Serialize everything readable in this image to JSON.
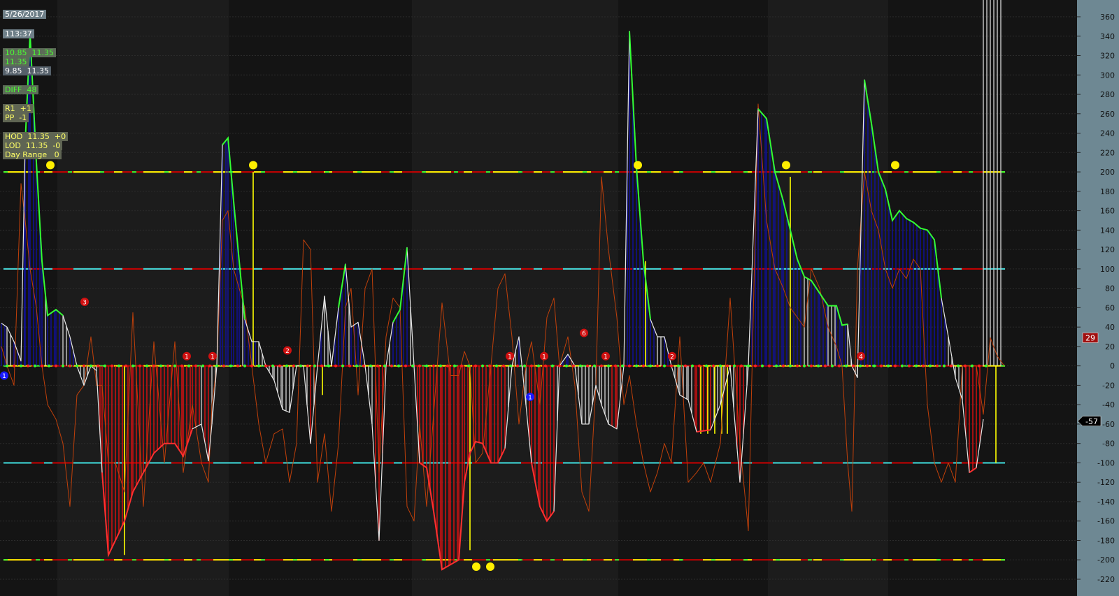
{
  "header": {
    "date": "5/26/2017",
    "price": "113:37",
    "bid_ask": "10.85  11.35",
    "last": "11.35",
    "range": "9.85  11.35",
    "diff": "DIFF  48",
    "r1": "R1  +1",
    "pp": "PP  -1",
    "hod": "HOD  11.35  +0",
    "lod": "LOD  11.35  -0",
    "day_range": "Day Range   0"
  },
  "colors": {
    "background": "#161616",
    "axis_panel": "#6e8893",
    "up_fill": "#1010a0",
    "down_fill": "#e01010",
    "neutral_stick": "#c8c8c8",
    "signal_stick": "#ffff00",
    "green_line": "#33ff33",
    "orange_line": "#c0400a",
    "cyan_level": "#40e0e0",
    "red_level": "#cc0000"
  },
  "chart_data": {
    "type": "line",
    "title": "",
    "xlabel": "",
    "ylabel": "",
    "ylim": [
      -220,
      360
    ],
    "y_ticks": [
      360,
      340,
      320,
      300,
      280,
      260,
      240,
      220,
      200,
      180,
      160,
      140,
      120,
      100,
      80,
      60,
      40,
      20,
      0,
      -20,
      -40,
      -60,
      -80,
      -100,
      -120,
      -140,
      -160,
      -180,
      -200,
      -220
    ],
    "grid": true,
    "reference_levels": [
      200,
      100,
      0,
      -100,
      -200
    ],
    "last_values": {
      "orange_series": 29,
      "main_series": -57
    },
    "x": [
      2,
      10,
      20,
      30,
      36,
      43,
      52,
      60,
      68,
      80,
      90,
      100,
      110,
      120,
      130,
      138,
      146,
      155,
      165,
      178,
      190,
      205,
      220,
      235,
      250,
      262,
      275,
      288,
      298,
      303,
      310,
      318,
      326,
      334,
      342,
      350,
      360,
      370,
      380,
      392,
      404,
      414,
      424,
      434,
      444,
      454,
      464,
      474,
      484,
      494,
      502,
      512,
      522,
      532,
      542,
      552,
      562,
      572,
      582,
      592,
      600,
      610,
      620,
      632,
      644,
      656,
      664,
      672,
      680,
      690,
      702,
      712,
      722,
      732,
      742,
      752,
      760,
      772,
      782,
      792,
      800,
      812,
      822,
      832,
      842,
      852,
      860,
      870,
      882,
      892,
      900,
      910,
      920,
      930,
      940,
      950,
      960,
      972,
      984,
      996,
      1006,
      1016,
      1030,
      1044,
      1058,
      1070,
      1084,
      1096,
      1108,
      1120,
      1130,
      1140,
      1150,
      1160,
      1172,
      1184,
      1196,
      1204,
      1212,
      1218,
      1226,
      1236,
      1246,
      1256,
      1266,
      1276,
      1286,
      1296,
      1306,
      1316,
      1326,
      1336,
      1346,
      1356,
      1366,
      1376,
      1386,
      1396,
      1406,
      1416,
      1426,
      1436
    ],
    "main_series": [
      44,
      40,
      25,
      5,
      230,
      342,
      210,
      108,
      52,
      58,
      52,
      30,
      0,
      -20,
      0,
      -5,
      -110,
      -195,
      -180,
      -160,
      -130,
      -110,
      -90,
      -80,
      -80,
      -93,
      -65,
      -60,
      -98,
      -60,
      0,
      228,
      235,
      170,
      108,
      48,
      25,
      25,
      0,
      -15,
      -45,
      -48,
      0,
      0,
      -80,
      0,
      72,
      0,
      60,
      105,
      40,
      45,
      0,
      -60,
      -180,
      0,
      45,
      58,
      122,
      0,
      -100,
      -105,
      -150,
      -210,
      -205,
      -200,
      -120,
      -90,
      -78,
      -80,
      -100,
      -100,
      -85,
      0,
      30,
      -40,
      -100,
      -145,
      -160,
      -150,
      0,
      12,
      0,
      -60,
      -60,
      -20,
      -40,
      -60,
      -65,
      0,
      345,
      205,
      108,
      48,
      30,
      30,
      0,
      -30,
      -35,
      -68,
      -67,
      -66,
      -40,
      0,
      -120,
      0,
      265,
      255,
      200,
      170,
      140,
      110,
      92,
      88,
      75,
      62,
      62,
      42,
      43,
      0,
      -12,
      295,
      250,
      200,
      182,
      150,
      160,
      152,
      148,
      142,
      140,
      130,
      70,
      30,
      -12,
      -35,
      -110,
      -105,
      -55
    ],
    "orange_series": [
      20,
      0,
      -20,
      188,
      150,
      100,
      60,
      0,
      -40,
      -55,
      -80,
      -145,
      -30,
      -20,
      30,
      -20,
      -20,
      -100,
      -100,
      -130,
      55,
      -145,
      25,
      -100,
      25,
      -110,
      -40,
      -100,
      -120,
      -40,
      0,
      150,
      160,
      100,
      80,
      60,
      0,
      -60,
      -100,
      -70,
      -65,
      -120,
      -80,
      130,
      120,
      -120,
      -70,
      -150,
      -80,
      60,
      80,
      -30,
      80,
      100,
      -110,
      30,
      70,
      60,
      -145,
      -160,
      -60,
      -145,
      -50,
      65,
      -10,
      -10,
      15,
      0,
      -100,
      -90,
      0,
      80,
      95,
      30,
      -60,
      0,
      25,
      -40,
      50,
      70,
      0,
      30,
      -20,
      -130,
      -150,
      -20,
      195,
      120,
      50,
      -40,
      -10,
      -60,
      -100,
      -130,
      -110,
      -80,
      -100,
      30,
      -120,
      -110,
      -100,
      -120,
      -80,
      70,
      -80,
      -170,
      270,
      150,
      100,
      80,
      60,
      50,
      40,
      100,
      80,
      40,
      20,
      0,
      -100,
      -150,
      100,
      200,
      160,
      140,
      100,
      80,
      100,
      90,
      110,
      100,
      -40,
      -100,
      -120,
      -100,
      -120,
      0,
      0,
      0,
      -50,
      29,
      10,
      0
    ],
    "signal_markers": [
      {
        "x": 72,
        "y": 207,
        "label": ""
      },
      {
        "x": 362,
        "y": 207,
        "label": ""
      },
      {
        "x": 912,
        "y": 207,
        "label": ""
      },
      {
        "x": 1124,
        "y": 207,
        "label": ""
      },
      {
        "x": 1280,
        "y": 207,
        "label": ""
      },
      {
        "x": 681,
        "y": -207,
        "label": ""
      },
      {
        "x": 701,
        "y": -207,
        "label": ""
      }
    ],
    "count_markers": [
      {
        "x": 121,
        "y": 66,
        "label": "3"
      },
      {
        "x": 267,
        "y": 10,
        "label": "1"
      },
      {
        "x": 304,
        "y": 10,
        "label": "1"
      },
      {
        "x": 411,
        "y": 16,
        "label": "2"
      },
      {
        "x": 729,
        "y": 10,
        "label": "1"
      },
      {
        "x": 778,
        "y": 10,
        "label": "1"
      },
      {
        "x": 835,
        "y": 34,
        "label": "6"
      },
      {
        "x": 866,
        "y": 10,
        "label": "1"
      },
      {
        "x": 961,
        "y": 10,
        "label": "2"
      },
      {
        "x": 1231,
        "y": 10,
        "label": "4"
      }
    ],
    "blue_markers": [
      {
        "x": 6,
        "y": -10,
        "label": "1"
      },
      {
        "x": 758,
        "y": -32,
        "label": "1"
      }
    ]
  }
}
